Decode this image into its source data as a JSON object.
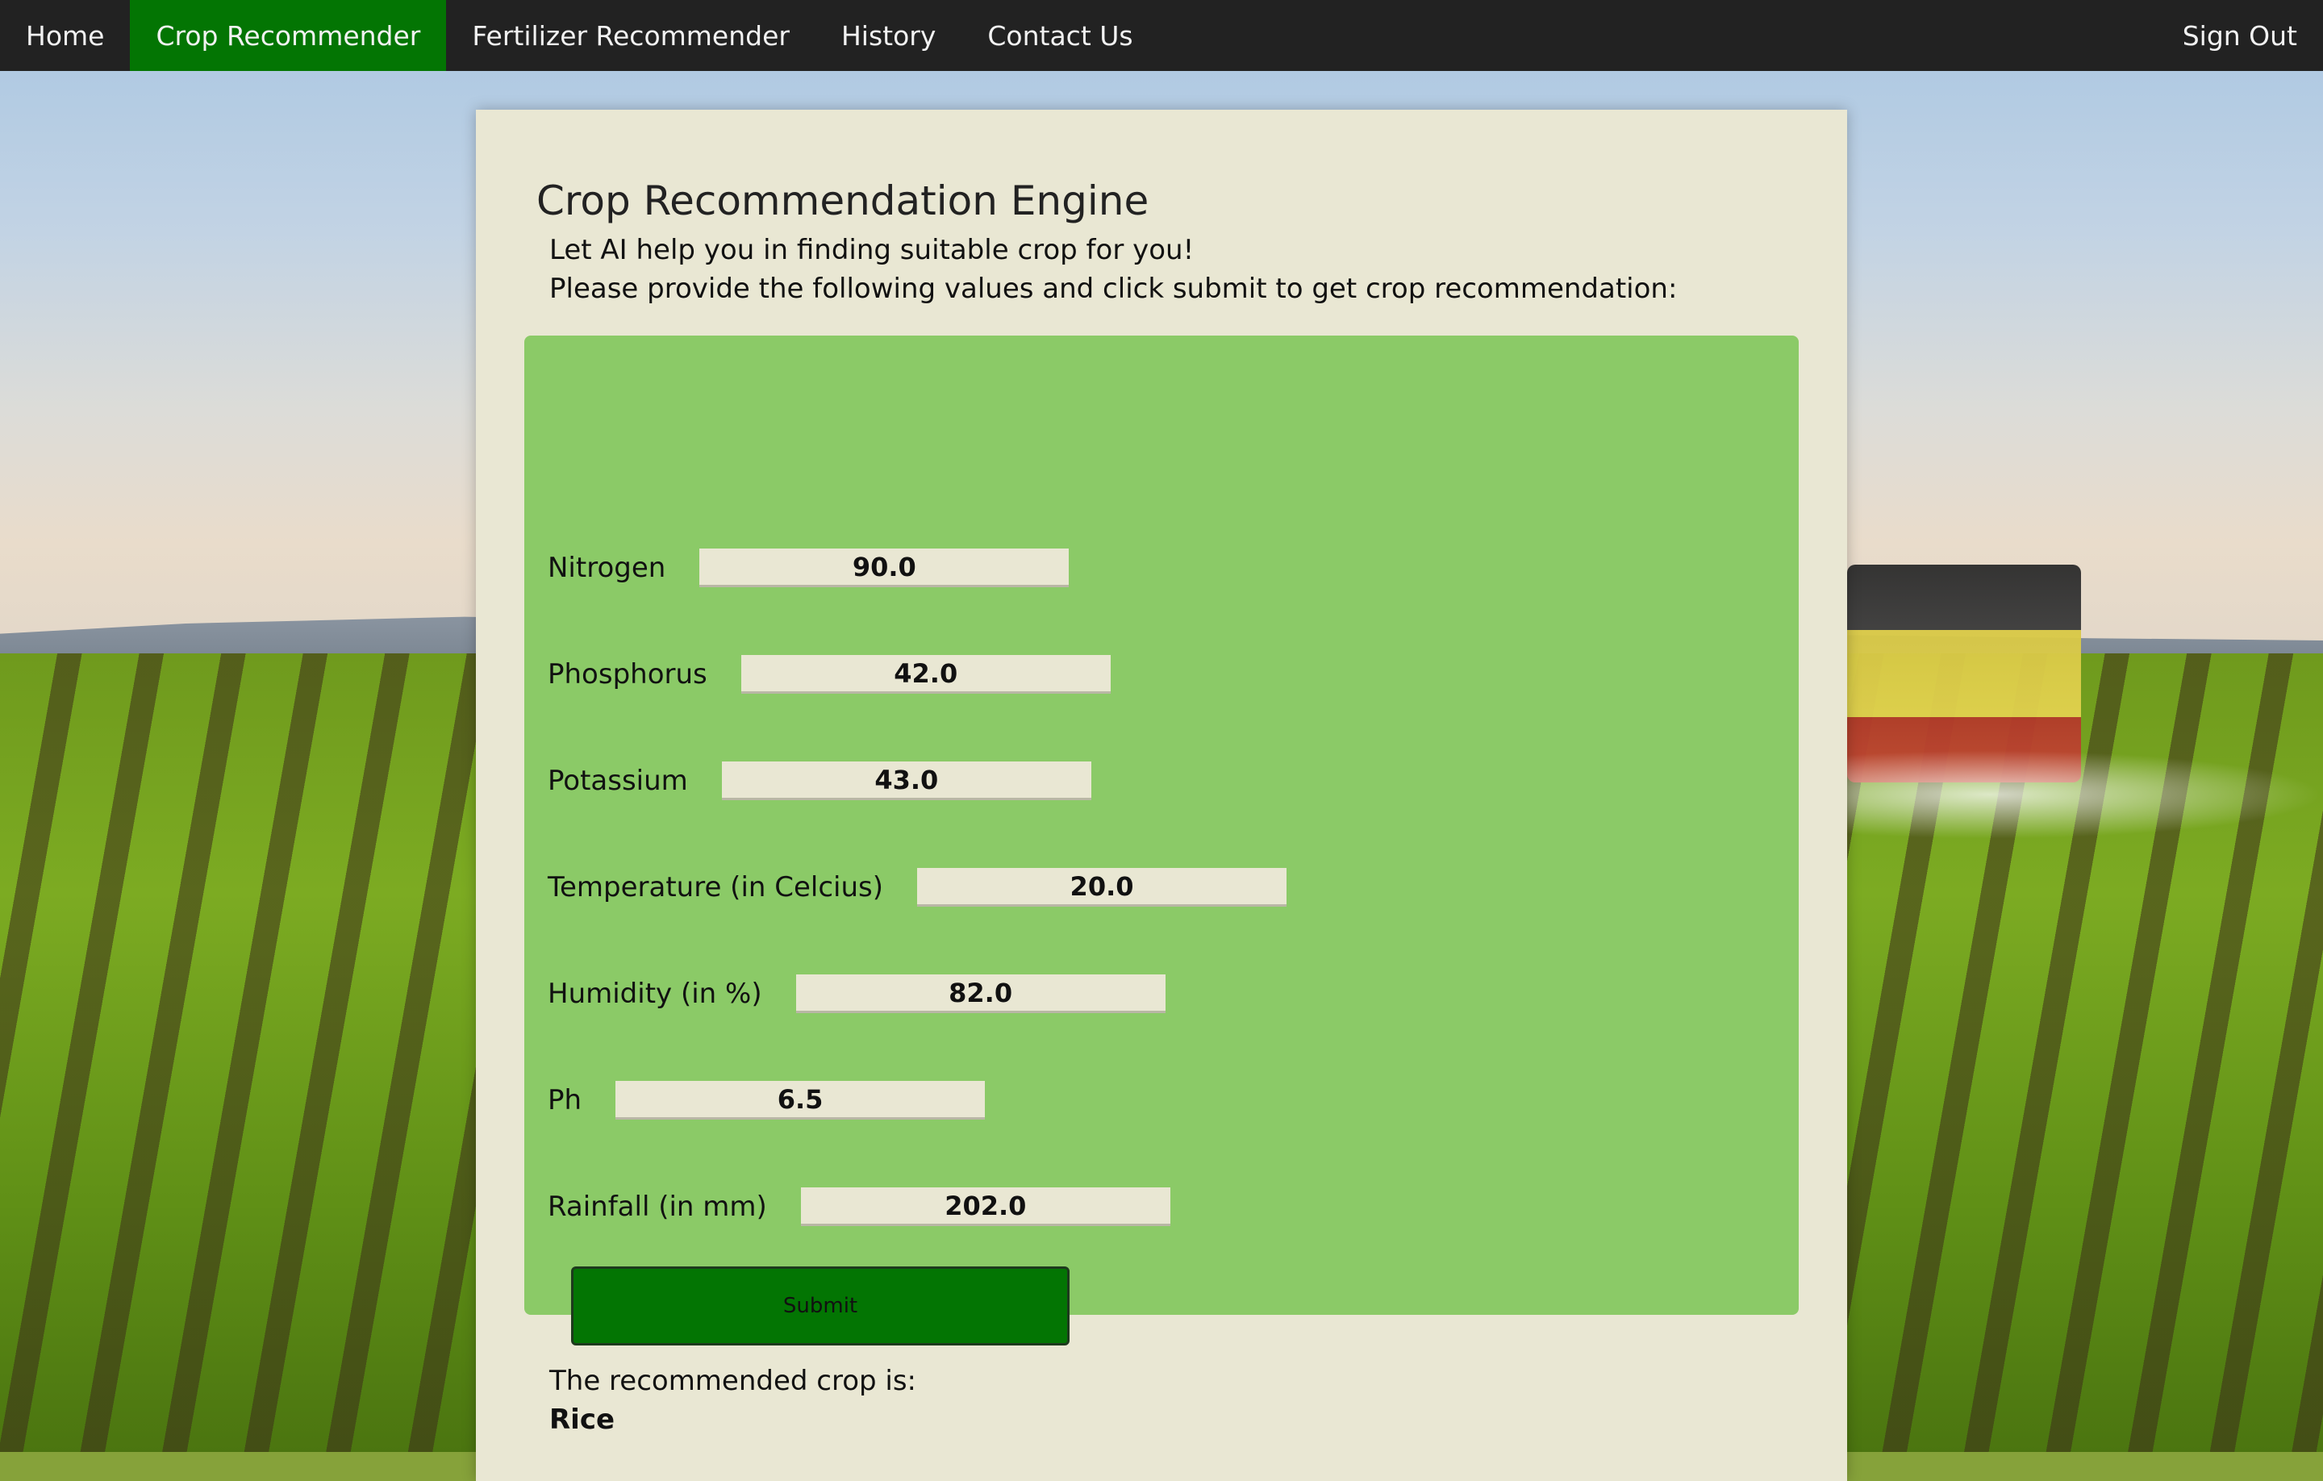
{
  "nav": {
    "items": [
      {
        "label": "Home"
      },
      {
        "label": "Crop Recommender"
      },
      {
        "label": "Fertilizer Recommender"
      },
      {
        "label": "History"
      },
      {
        "label": "Contact Us"
      }
    ],
    "sign_out": "Sign Out",
    "active_color": "#037503"
  },
  "page": {
    "title": "Crop Recommendation Engine",
    "subtitle": "Let AI help you in finding suitable crop for you!",
    "instructions": "Please provide the following values and click submit to get crop recommendation:"
  },
  "form": {
    "fields": [
      {
        "label": "Nitrogen",
        "value": "90.0"
      },
      {
        "label": "Phosphorus",
        "value": "42.0"
      },
      {
        "label": "Potassium",
        "value": "43.0"
      },
      {
        "label": "Temperature (in Celcius)",
        "value": "20.0"
      },
      {
        "label": "Humidity (in %)",
        "value": "82.0"
      },
      {
        "label": "Ph",
        "value": "6.5"
      },
      {
        "label": "Rainfall (in mm)",
        "value": "202.0"
      }
    ],
    "submit_label": "Submit",
    "panel_color": "#8bca67",
    "button_color": "#037503"
  },
  "result": {
    "label": "The recommended crop is:",
    "crop": "Rice"
  }
}
